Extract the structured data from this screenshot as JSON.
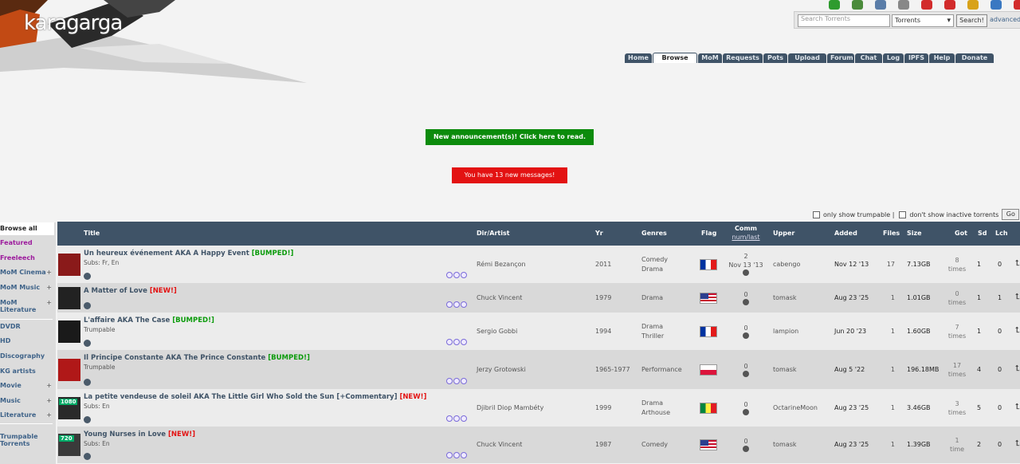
{
  "header": {
    "logo_text": "karagarga"
  },
  "top_icons": [
    {
      "icon": "dollar-icon",
      "color": "#2e9b2e"
    },
    {
      "icon": "upload-icon",
      "color": "#4b8b3b"
    },
    {
      "icon": "document-icon",
      "color": "#5a7da8"
    },
    {
      "icon": "tools-icon",
      "color": "#888888"
    },
    {
      "icon": "lifebuoy-icon",
      "color": "#d22b2b"
    },
    {
      "icon": "heart-icon",
      "color": "#d22b2b"
    },
    {
      "icon": "puzzle-icon",
      "color": "#d8a21a"
    },
    {
      "icon": "users-icon",
      "color": "#3a78c2"
    },
    {
      "icon": "power-icon",
      "color": "#d22b2b"
    }
  ],
  "search": {
    "placeholder": "Search Torrents",
    "category": "Torrents",
    "button": "Search!",
    "advanced": "advanced"
  },
  "nav": {
    "tabs": [
      "Home",
      "Browse",
      "MoM",
      "Requests",
      "Pots",
      "Upload",
      "Forum",
      "Chat",
      "Log",
      "IPFS",
      "Help",
      "Donate"
    ],
    "active": "Browse"
  },
  "announcement": "New announcement(s)! Click here to read.",
  "messages": "You have 13 new messages!",
  "filters": {
    "trumpable": "only show trumpable |",
    "inactive": "don't show inactive torrents",
    "go": "Go"
  },
  "sidebar": {
    "items": [
      {
        "label": "Browse all",
        "plus": false
      },
      {
        "label": "Featured",
        "plus": false
      },
      {
        "label": "Freeleech",
        "plus": false
      },
      {
        "label": "MoM Cinema",
        "plus": true
      },
      {
        "label": "MoM Music",
        "plus": true
      },
      {
        "label": "MoM",
        "label2": "Literature",
        "plus": true
      },
      {
        "label": "DVDR",
        "plus": false
      },
      {
        "label": "HD",
        "plus": false
      },
      {
        "label": "Discography",
        "plus": false
      },
      {
        "label": "KG artists",
        "plus": false
      },
      {
        "label": "Movie",
        "plus": true
      },
      {
        "label": "Music",
        "plus": true
      },
      {
        "label": "Literature",
        "plus": true
      },
      {
        "label": "Trumpable",
        "label2": "Torrents",
        "plus": false
      }
    ]
  },
  "table": {
    "headers": {
      "title": "Title",
      "artist": "Dir/Artist",
      "yr": "Yr",
      "genres": "Genres",
      "flag": "Flag",
      "comm": "Comm",
      "comm_sub": "num/last",
      "upper": "Upper",
      "added": "Added",
      "files": "Files",
      "size": "Size",
      "got": "Got",
      "sd": "Sd",
      "lch": "Lch"
    },
    "rows": [
      {
        "title": "Un heureux événement AKA A Happy Event",
        "tag": "[BUMPED!]",
        "tag_type": "bumped",
        "subs": "Subs: Fr, En",
        "artist": "Rémi Bezançon",
        "yr": "2011",
        "genres": [
          "Comedy",
          "Drama"
        ],
        "flag": "fr",
        "comm": "2",
        "comm_last": "Nov 13 '13",
        "upper": "cabengo",
        "added": "Nov 12 '13",
        "files": "17",
        "size": "7.13GB",
        "got": "8",
        "got_unit": "times",
        "sd": "1",
        "lch": "0",
        "thumb_color": "#8a1a1a"
      },
      {
        "title": "A Matter of Love",
        "tag": "[NEW!]",
        "tag_type": "new",
        "subs": "",
        "artist": "Chuck Vincent",
        "yr": "1979",
        "genres": [
          "Drama"
        ],
        "flag": "us",
        "comm": "0",
        "comm_last": "",
        "upper": "tomask",
        "added": "Aug 23 '25",
        "files": "1",
        "size": "1.01GB",
        "got": "0",
        "got_unit": "times",
        "sd": "1",
        "lch": "1",
        "thumb_color": "#222222"
      },
      {
        "title": "L'affaire AKA The Case",
        "tag": "[BUMPED!]",
        "tag_type": "bumped",
        "subs": "Trumpable",
        "artist": "Sergio Gobbi",
        "yr": "1994",
        "genres": [
          "Drama",
          "Thriller"
        ],
        "flag": "fr",
        "comm": "0",
        "comm_last": "",
        "upper": "lampion",
        "added": "Jun 20 '23",
        "files": "1",
        "size": "1.60GB",
        "got": "7",
        "got_unit": "times",
        "sd": "1",
        "lch": "0",
        "thumb_color": "#1a1a1a"
      },
      {
        "title": "Il Principe Constante AKA The Prince Constante",
        "tag": "[BUMPED!]",
        "tag_type": "bumped",
        "subs": "Trumpable",
        "artist": "Jerzy Grotowski",
        "yr": "1965-1977",
        "genres": [
          "Performance"
        ],
        "flag": "pl",
        "comm": "0",
        "comm_last": "",
        "upper": "tomask",
        "added": "Aug 5 '22",
        "files": "1",
        "size": "196.18MB",
        "got": "17",
        "got_unit": "times",
        "sd": "4",
        "lch": "0",
        "thumb_color": "#b01818"
      },
      {
        "title": "La petite vendeuse de soleil AKA The Little Girl Who Sold the Sun [+Commentary]",
        "tag": "[NEW!]",
        "tag_type": "new",
        "subs": "Subs: En",
        "artist": "Djibril Diop Mambéty",
        "yr": "1999",
        "genres": [
          "Drama",
          "Arthouse"
        ],
        "flag": "sn",
        "comm": "0",
        "comm_last": "",
        "upper": "OctarineMoon",
        "added": "Aug 23 '25",
        "files": "1",
        "size": "3.46GB",
        "got": "3",
        "got_unit": "times",
        "sd": "5",
        "lch": "0",
        "thumb_color": "#2a2a2a",
        "badge": "1080"
      },
      {
        "title": "Young Nurses in Love",
        "tag": "[NEW!]",
        "tag_type": "new",
        "subs": "Subs: En",
        "artist": "Chuck Vincent",
        "yr": "1987",
        "genres": [
          "Comedy"
        ],
        "flag": "us",
        "comm": "0",
        "comm_last": "",
        "upper": "tomask",
        "added": "Aug 23 '25",
        "files": "1",
        "size": "1.39GB",
        "got": "1",
        "got_unit": "time",
        "sd": "2",
        "lch": "0",
        "thumb_color": "#3a3a3a",
        "badge": "720"
      }
    ]
  }
}
